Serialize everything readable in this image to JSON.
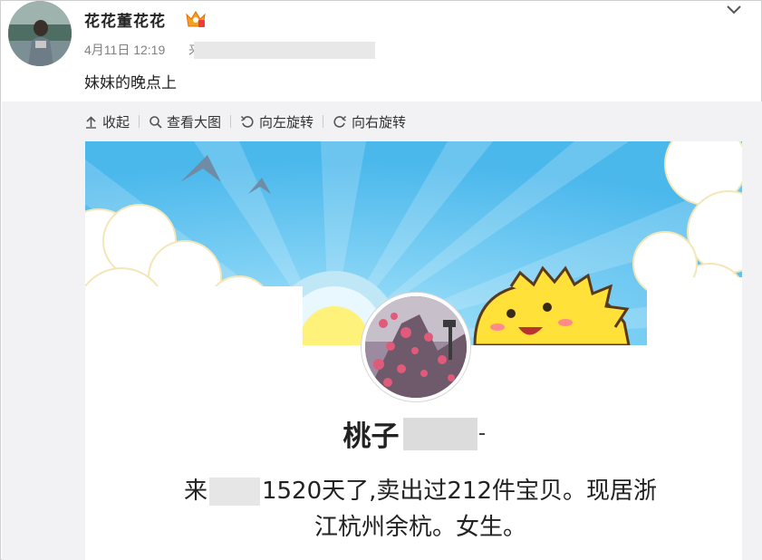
{
  "post": {
    "user_name": "花花董花花",
    "date": "4月11日 12:19",
    "meta_cut_char": "来",
    "text": "妹妹的晚点上"
  },
  "toolbar": {
    "collapse_label": "收起",
    "view_large_label": "查看大图",
    "rotate_left_label": "向左旋转",
    "rotate_right_label": "向右旋转"
  },
  "screenshot": {
    "shop_name_visible": "桃子",
    "desc_prefix": "来",
    "desc_line1_rest": "1520天了,卖出过212件宝贝。现居浙",
    "desc_line2": "江杭州余杭。女生。"
  },
  "icons": {
    "vip": "vip-crown-icon",
    "chevron": "chevron-down-icon",
    "collapse": "collapse-up-icon",
    "zoom": "magnifier-icon",
    "rotate_left": "rotate-left-icon",
    "rotate_right": "rotate-right-icon"
  },
  "colors": {
    "sky": "#5cc2f0",
    "cloud": "#ffffff",
    "sun": "#fff27a",
    "mascot": "#ffe13a",
    "redaction": "#e4e4e4"
  }
}
